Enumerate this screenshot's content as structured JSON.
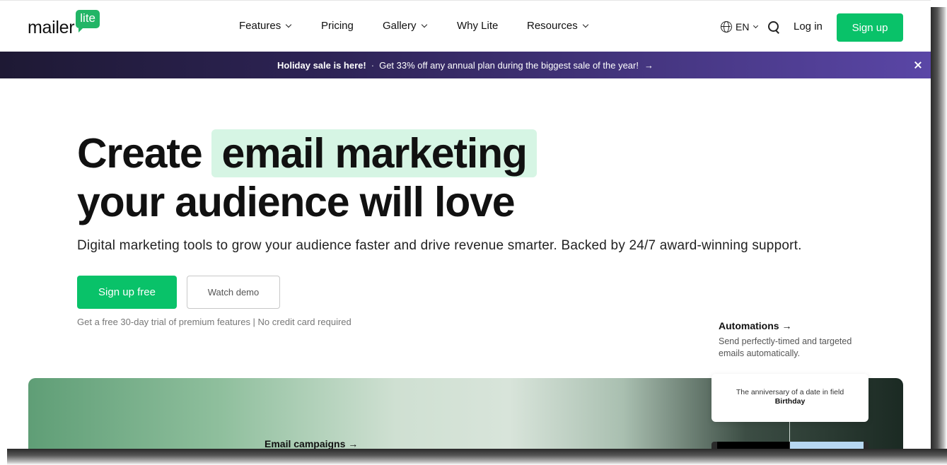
{
  "header": {
    "logo_word": "mailer",
    "logo_badge": "lite",
    "nav": [
      {
        "label": "Features",
        "dropdown": true
      },
      {
        "label": "Pricing",
        "dropdown": false
      },
      {
        "label": "Gallery",
        "dropdown": true
      },
      {
        "label": "Why Lite",
        "dropdown": false
      },
      {
        "label": "Resources",
        "dropdown": true
      }
    ],
    "language": "EN",
    "login_label": "Log in",
    "signup_label": "Sign up"
  },
  "banner": {
    "bold_text": "Holiday sale is here!",
    "separator": "·",
    "text": "Get 33% off any annual plan during the biggest sale of the year!",
    "arrow": "→"
  },
  "hero": {
    "title_part1": "Create",
    "title_highlight": "email marketing",
    "title_line2": "your audience will love",
    "subtitle": "Digital marketing tools to grow your audience faster and drive revenue smarter. Backed by 24/7 award-winning support.",
    "primary_cta": "Sign up free",
    "secondary_cta": "Watch demo",
    "trial_note": "Get a free 30-day trial of premium features | No credit card required"
  },
  "features": {
    "automations_title": "Automations →",
    "automations_desc": "Send perfectly-timed and targeted emails automatically.",
    "email_campaigns_title": "Email campaigns →"
  },
  "automation_card": {
    "text": "The anniversary of a date in field",
    "field_name": "Birthday"
  },
  "colors": {
    "brand_green": "#09c269",
    "highlight": "#d6f5e4",
    "banner_start": "#1e1934",
    "banner_end": "#5a46a6"
  }
}
